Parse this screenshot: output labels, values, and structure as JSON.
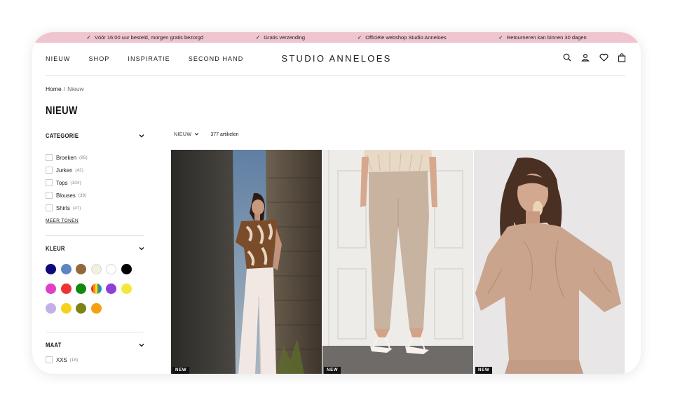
{
  "usp_bar": {
    "items": [
      "Vóór 16:00 uur besteld, morgen gratis bezorgd",
      "Gratis verzending",
      "Officiële webshop Studio Anneloes",
      "Retourneren kan binnen 30 dagen"
    ],
    "background": "#efc5cf"
  },
  "header": {
    "nav": [
      "NIEUW",
      "SHOP",
      "INSPIRATIE",
      "SECOND HAND"
    ],
    "logo": "STUDIO ANNELOES",
    "icons": [
      "search-icon",
      "account-icon",
      "heart-icon",
      "bag-icon"
    ]
  },
  "breadcrumb": {
    "home": "Home",
    "separator": "/",
    "current": "Nieuw"
  },
  "page_title": "NIEUW",
  "filters": {
    "category": {
      "title": "CATEGORIE",
      "items": [
        {
          "label": "Broeken",
          "count": "(85)"
        },
        {
          "label": "Jurken",
          "count": "(42)"
        },
        {
          "label": "Tops",
          "count": "(104)"
        },
        {
          "label": "Blouses",
          "count": "(39)"
        },
        {
          "label": "Shirts",
          "count": "(47)"
        }
      ],
      "more_label": "MEER TONEN"
    },
    "color": {
      "title": "KLEUR",
      "swatches": [
        "#0a0a7a",
        "#5b86c4",
        "#93693b",
        "#f3f1dc",
        "#ffffff",
        "#000000",
        "#e040c8",
        "#ee3333",
        "#118811",
        "multicolor",
        "#8d3fd8",
        "#f3e73c",
        "#c3b0e8",
        "#f5d21d",
        "#7b8415",
        "#f5a00e"
      ]
    },
    "size": {
      "title": "MAAT",
      "items": [
        {
          "label": "XXS",
          "count": "(18)"
        }
      ]
    }
  },
  "toolbar": {
    "sort_label": "NIEUW",
    "result_count": "377 artikelen"
  },
  "products": [
    {
      "badge": "NEW"
    },
    {
      "badge": "NEW"
    },
    {
      "badge": "NEW"
    }
  ]
}
